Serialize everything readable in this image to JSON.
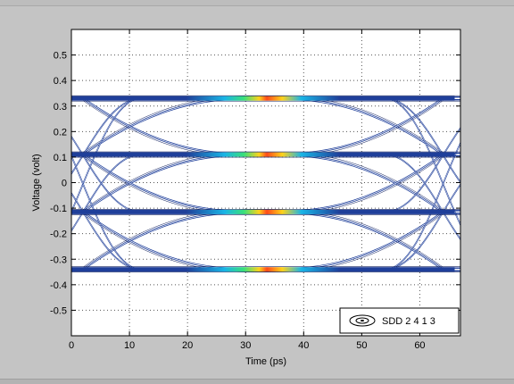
{
  "chart_data": {
    "type": "contour",
    "xlabel": "Time (ps)",
    "ylabel": "Voltage (volt)",
    "xlim": [
      0,
      67
    ],
    "ylim": [
      -0.6,
      0.6
    ],
    "xticks": [
      0,
      10,
      20,
      30,
      40,
      50,
      60
    ],
    "yticks": [
      -0.5,
      -0.4,
      -0.3,
      -0.2,
      -0.1,
      0,
      0.1,
      0.2,
      0.3,
      0.4,
      0.5
    ],
    "grid": true,
    "legend": {
      "position": "bottom-right",
      "label": "SDD 2 4 1 3"
    },
    "series": [
      {
        "name": "SDD 2 4 1 3",
        "eye_levels": [
          -0.34,
          -0.115,
          0.11,
          0.33
        ],
        "eye_center_ps": 33
      }
    ],
    "colors": {
      "contour": "#1f3f9a",
      "contour_dark": "#0b1a5a",
      "hot": "#ff4a1a",
      "warm": "#ffd21a",
      "mid": "#39e07a",
      "cool": "#19b5e6"
    }
  }
}
